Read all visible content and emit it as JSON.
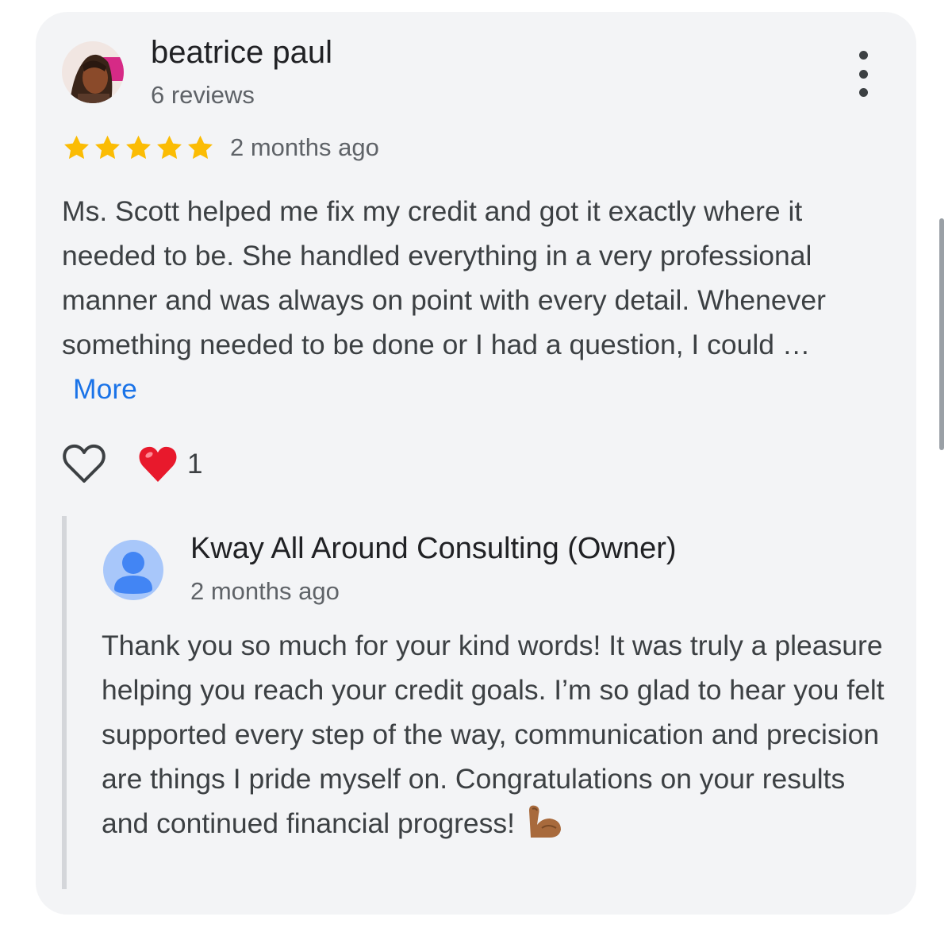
{
  "review": {
    "reviewer_name": "beatrice paul",
    "reviewer_meta": "6 reviews",
    "rating": 5,
    "date": "2 months ago",
    "text": "Ms. Scott helped me fix my credit and got it exactly where it needed to be. She handled everything in a very professional manner and was always on point with every detail. Whenever something needed to be done or I had a question, I could …",
    "more_label": "More",
    "reaction_count": "1"
  },
  "owner_reply": {
    "name": "Kway All Around Consulting (Owner)",
    "date": "2 months ago",
    "text": "Thank you so much for your kind words! It was truly a pleasure helping you reach your credit goals. I’m so glad to hear you felt supported every step of the way, communication and precision are things I pride myself on. Congratulations on your results and continued financial progress!"
  },
  "colors": {
    "card_background": "#f3f4f6",
    "star": "#fbbc04",
    "link": "#1a73e8",
    "owner_avatar": "#a8c7fa",
    "owner_avatar_figure": "#4285f4"
  },
  "icons": {
    "menu": "more-vert-icon",
    "like": "heart-outline-icon",
    "reaction": "red-heart-emoji",
    "owner_avatar": "person-icon",
    "reply_emoji": "flexed-biceps-emoji"
  }
}
